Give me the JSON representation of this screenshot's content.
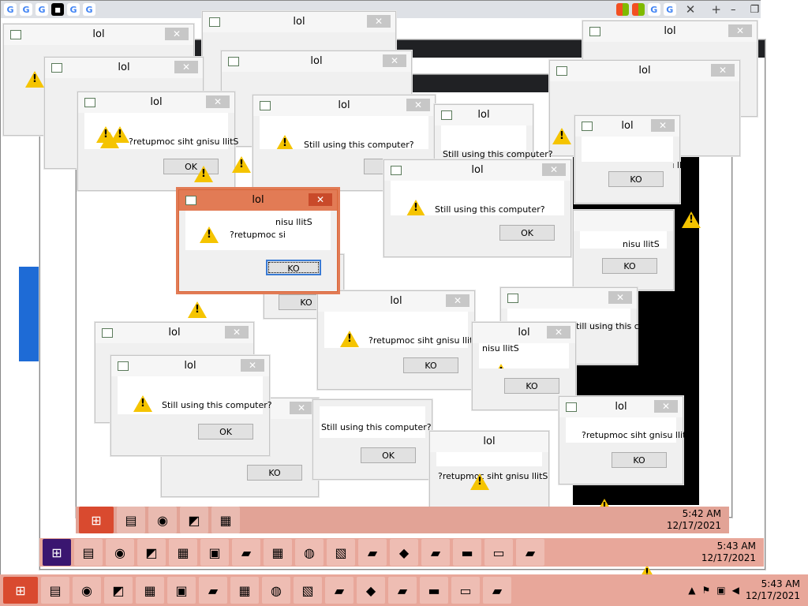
{
  "dialog": {
    "title": "lol",
    "message": "Still using this computer?",
    "message_reversed": "?retupmoc siht gnisu llitS",
    "active_line1": "nisu llitS",
    "active_line2": "?retupmoc si",
    "ok_label": "OK",
    "ok_reversed": "KO",
    "close_glyph": "✕"
  },
  "browser": {
    "google_letter": "G",
    "new_tab": "+",
    "tab_close": "✕",
    "min": "–",
    "max": "❐",
    "close": "✕"
  },
  "taskbar": {
    "time_main": "5:43 AM",
    "date_main": "12/17/2021",
    "time_2": "5:43 AM",
    "date_2": "12/17/2021",
    "time_3": "5:42 AM",
    "date_3": "12/17/2021",
    "time_4": "5:42 AM",
    "date_4": "12/17/2021",
    "app_icons": [
      "start-icon",
      "explorer-icon",
      "chrome-icon",
      "paint-icon",
      "notepad-icon",
      "image-icon",
      "toolbox-icon",
      "calculator-icon",
      "palette-icon",
      "network-icon",
      "toolbox-icon",
      "registry-icon",
      "toolbox-icon",
      "cmd-icon",
      "monitor-icon",
      "toolbox-icon"
    ]
  },
  "colors": {
    "warning": "#f5c400",
    "active_title": "#e27b55",
    "taskbar": "#e8a79a",
    "start": "#d94a2f"
  }
}
